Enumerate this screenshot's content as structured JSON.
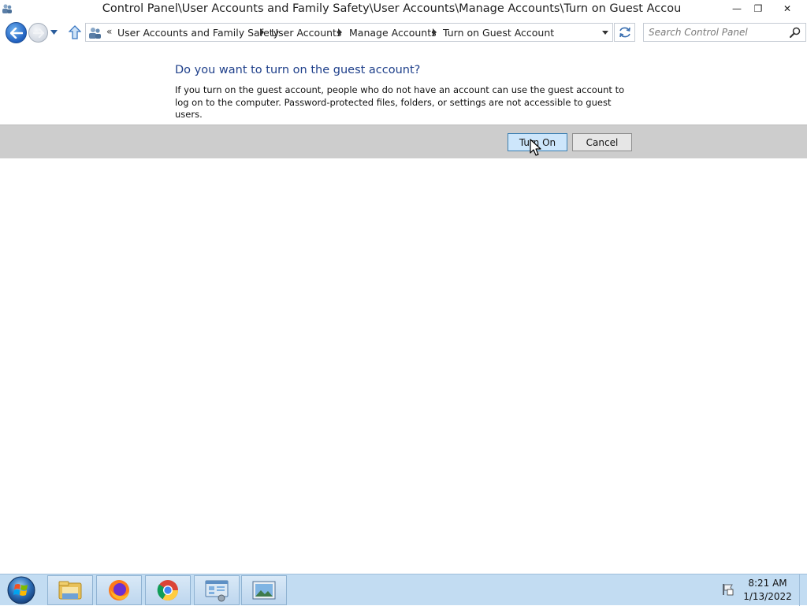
{
  "window": {
    "title": "Control Panel\\User Accounts and Family Safety\\User Accounts\\Manage Accounts\\Turn on Guest Accou",
    "controls": {
      "minimize": "—",
      "maximize": "❐",
      "close": "✕"
    }
  },
  "navbar": {
    "back_icon": "back-arrow-icon",
    "forward_icon": "forward-arrow-icon",
    "address_overflow": "«",
    "breadcrumbs": [
      "User Accounts and Family Safety",
      "User Accounts",
      "Manage Accounts",
      "Turn on Guest Account"
    ],
    "search_placeholder": "Search Control Panel"
  },
  "content": {
    "heading": "Do you want to turn on the guest account?",
    "description": "If you turn on the guest account, people who do not have an account can use the guest account to log on to the computer. Password-protected files, folders, or settings are not accessible to guest users."
  },
  "buttons": {
    "turn_on": "Turn On",
    "cancel": "Cancel"
  },
  "taskbar": {
    "apps": [
      "file-explorer",
      "firefox",
      "chrome",
      "control-panel",
      "image-viewer"
    ],
    "clock_time": "8:21 AM",
    "clock_date": "1/13/2022"
  },
  "colors": {
    "heading": "#1e3f8a",
    "button_bar": "#cdcdcd",
    "taskbar": "#c2dcf2",
    "primary_button": "#cde6fb"
  }
}
